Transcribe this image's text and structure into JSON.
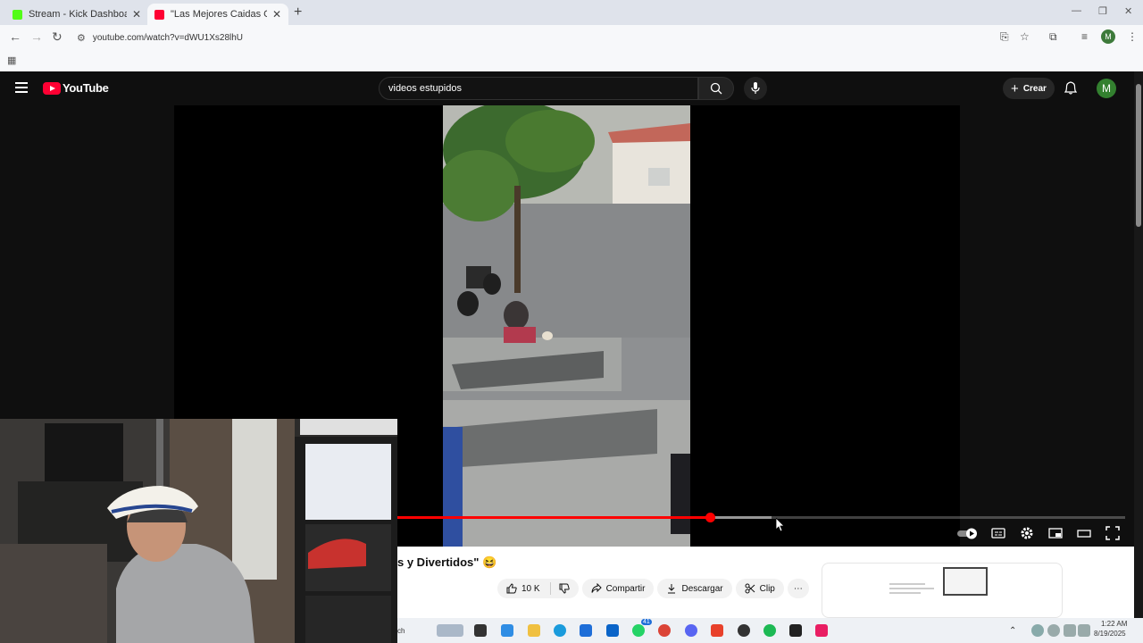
{
  "browser": {
    "tabs": [
      {
        "title": "Stream - Kick Dashboard",
        "favicon_color": "#53fc18",
        "active": false
      },
      {
        "title": "\"Las Mejores Caidas Graciosas",
        "favicon_color": "#ff0033",
        "active": true
      }
    ],
    "url": "youtube.com/watch?v=dWU1Xs28lhU",
    "profile_initial": "M"
  },
  "youtube": {
    "logo_text": "YouTube",
    "search_value": "videos estupidos",
    "create_label": "Crear",
    "avatar_initial": "M"
  },
  "player": {
    "progress_fraction": 0.429,
    "buffered_fraction": 0.514
  },
  "video": {
    "title_fragment": "s y Divertidos\" 😆",
    "like_count": "10 K",
    "share_label": "Compartir",
    "download_label": "Descargar",
    "clip_label": "Clip"
  },
  "taskbar": {
    "search_fragment": "ch",
    "time": "1:22 AM",
    "date": "8/19/2025",
    "badge_count": "41"
  },
  "colors": {
    "accent_red": "#ff0033",
    "yt_bg": "#0f0f0f"
  }
}
